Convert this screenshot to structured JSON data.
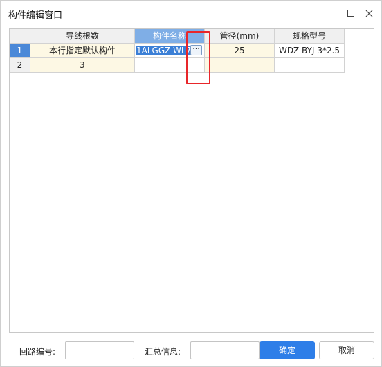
{
  "window": {
    "title": "构件编辑窗口"
  },
  "table": {
    "columns": [
      "导线根数",
      "构件名称",
      "管径(mm)",
      "规格型号"
    ],
    "rows": [
      {
        "num": "1",
        "wire_count": "本行指定默认构件",
        "name": "1ALGGZ-WL7",
        "diameter": "25",
        "spec": "WDZ-BYJ-3*2.5"
      },
      {
        "num": "2",
        "wire_count": "3",
        "name": "",
        "diameter": "",
        "spec": ""
      }
    ],
    "ellipsis": "···"
  },
  "footer": {
    "circuit_label": "回路编号:",
    "circuit_value": "",
    "summary_label": "汇总信息:",
    "summary_value": "",
    "confirm_label": "确定",
    "cancel_label": "取消"
  },
  "colors": {
    "accent": "#2e7ee8",
    "highlight": "#e8262a"
  }
}
